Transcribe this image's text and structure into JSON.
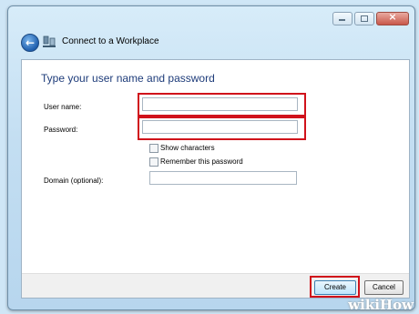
{
  "window": {
    "title": "Connect to a Workplace"
  },
  "caption": {
    "close_symbol": "×"
  },
  "nav": {
    "back_symbol": "←"
  },
  "main": {
    "heading": "Type your user name and password",
    "username_label": "User name:",
    "username_value": "",
    "password_label": "Password:",
    "password_value": "",
    "show_characters_label": "Show characters",
    "show_characters_checked": false,
    "remember_label": "Remember this password",
    "remember_checked": false,
    "domain_label": "Domain (optional):",
    "domain_value": ""
  },
  "buttons": {
    "create": "Create",
    "cancel": "Cancel"
  },
  "highlight_color": "#d0121b",
  "watermark": "wikiHow",
  "icons": {
    "back": "back-arrow-icon",
    "network": "network-connection-icon"
  }
}
